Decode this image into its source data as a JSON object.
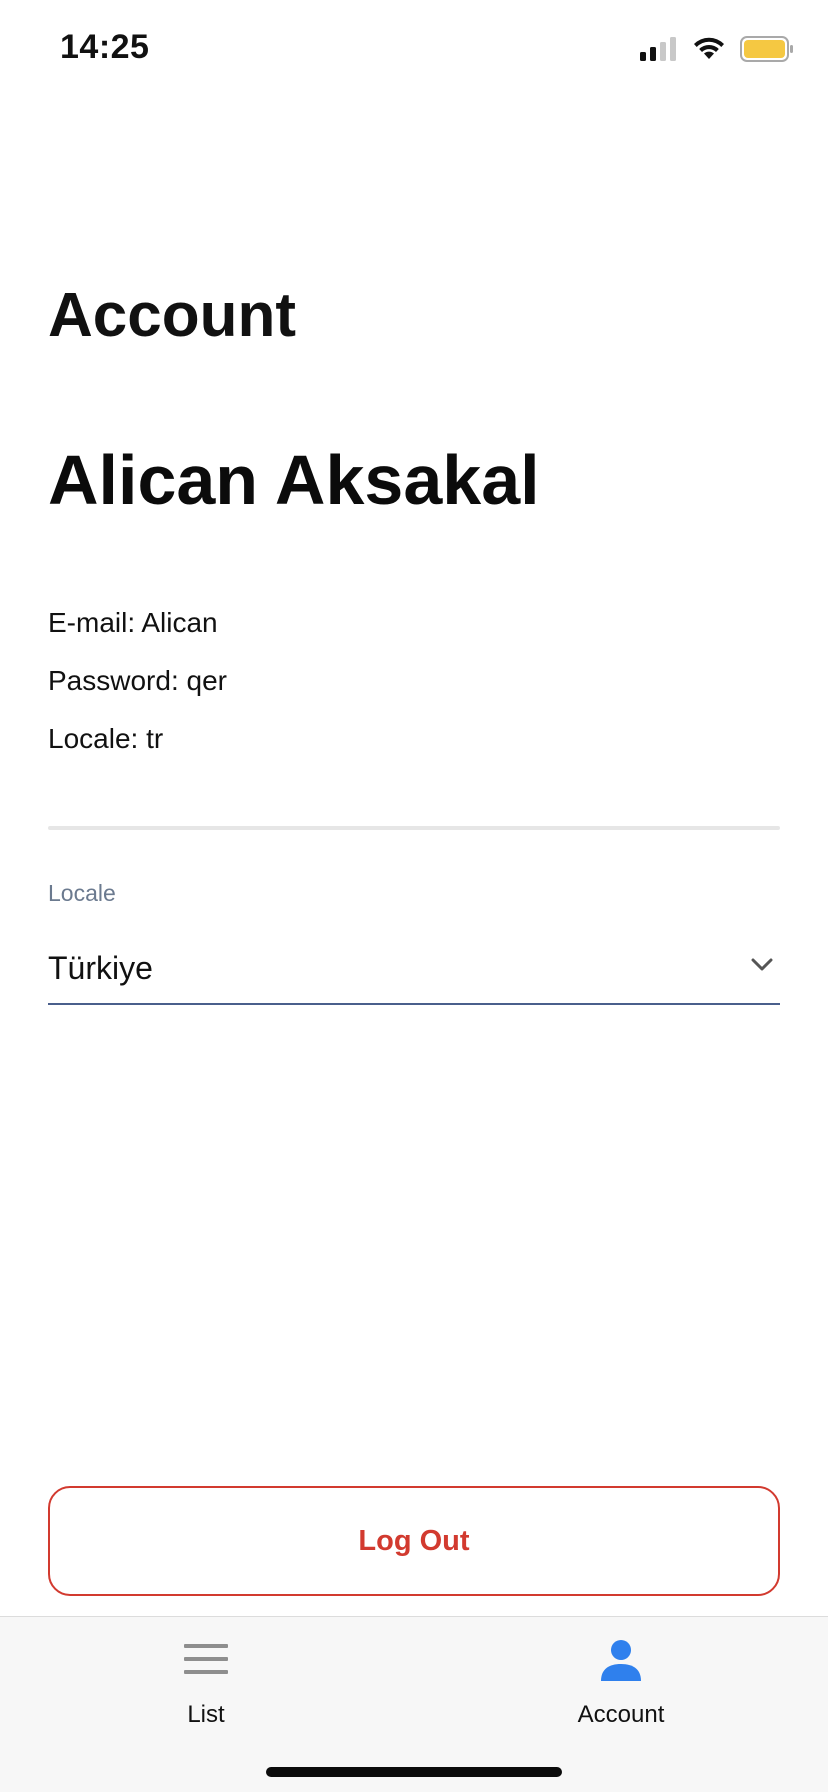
{
  "status_bar": {
    "time": "14:25",
    "icons": [
      "signal-icon",
      "wifi-icon",
      "battery-icon"
    ],
    "battery_color": "#f5c842"
  },
  "page": {
    "title": "Account"
  },
  "profile": {
    "name": "Alican Aksakal",
    "email_line": "E-mail: Alican",
    "password_line": "Password: qer",
    "locale_line": "Locale: tr"
  },
  "locale_field": {
    "label": "Locale",
    "selected_value": "Türkiye",
    "label_color": "#6b7a8f",
    "underline_color": "#4a5f8c"
  },
  "actions": {
    "logout_label": "Log Out",
    "logout_color": "#d23a2f"
  },
  "tab_bar": {
    "tabs": [
      {
        "label": "List",
        "icon": "list-icon",
        "active": false,
        "color": "#8e8e8e"
      },
      {
        "label": "Account",
        "icon": "person-icon",
        "active": true,
        "color": "#2f80ed"
      }
    ]
  }
}
